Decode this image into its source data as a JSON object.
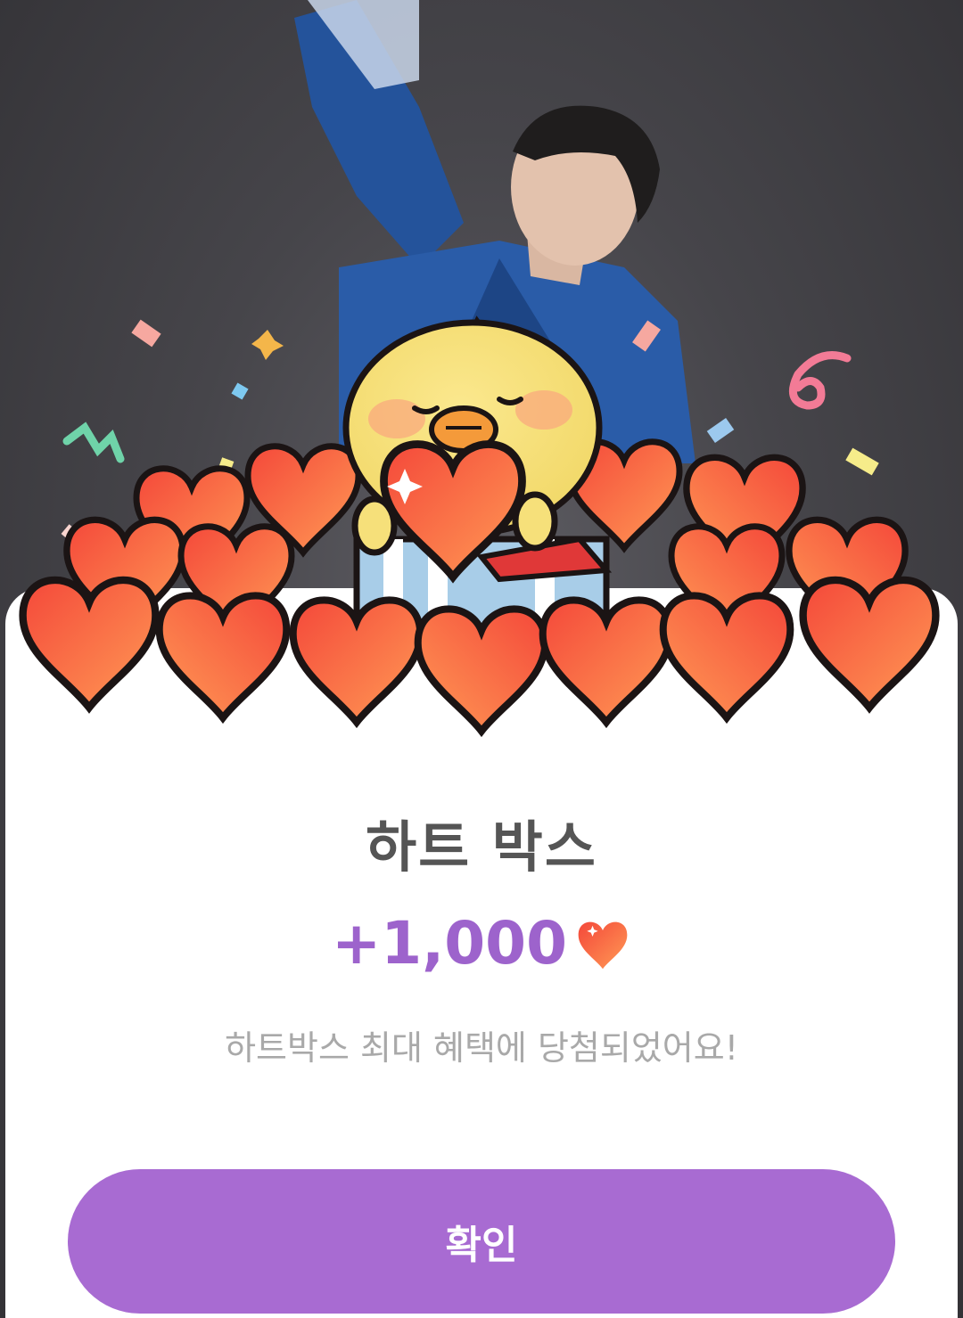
{
  "popup": {
    "title": "하트 박스",
    "reward_amount": "+1,000",
    "reward_icon": "heart-icon",
    "message": "하트박스 최대 혜택에 당첨되었어요!",
    "confirm_label": "확인"
  },
  "colors": {
    "accent": "#a86bd2",
    "reward_text": "#9d63cc",
    "title_text": "#555555",
    "message_text": "#a9a9a9",
    "heart_red": "#f0503c",
    "heart_orange": "#ff8a50",
    "chick_yellow": "#f6e07a"
  }
}
